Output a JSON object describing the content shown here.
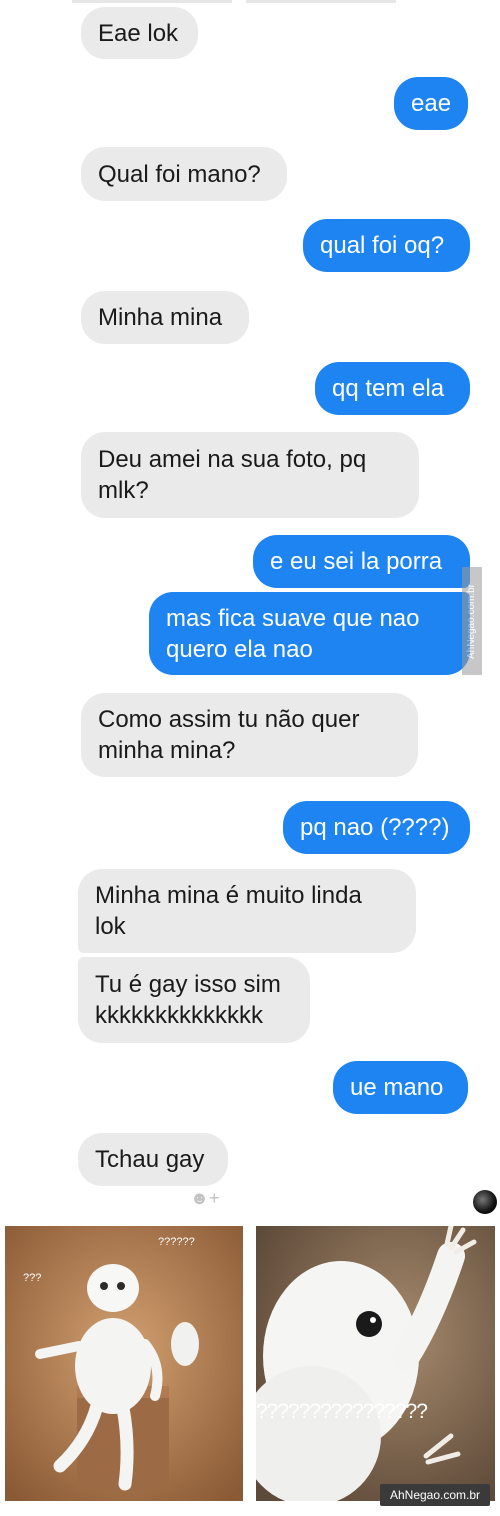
{
  "conversation": {
    "messages": [
      {
        "direction": "in",
        "text": "Eae lok"
      },
      {
        "direction": "out",
        "text": "eae"
      },
      {
        "direction": "in",
        "text": "Qual foi mano?"
      },
      {
        "direction": "out",
        "text": "qual foi oq?"
      },
      {
        "direction": "in",
        "text": "Minha mina"
      },
      {
        "direction": "out",
        "text": "qq tem ela"
      },
      {
        "direction": "in",
        "text": "Deu amei na sua foto, pq\nmlk?"
      },
      {
        "direction": "out",
        "text": "e eu sei la porra"
      },
      {
        "direction": "out",
        "text": "mas fica suave que nao\nquero ela nao"
      },
      {
        "direction": "in",
        "text": "Como assim tu não quer\nminha mina?"
      },
      {
        "direction": "out",
        "text": "pq nao (????)"
      },
      {
        "direction": "in",
        "text": "Minha mina é muito linda\nlok"
      },
      {
        "direction": "in",
        "text": "Tu é gay isso sim\nkkkkkkkkkkkkkk"
      },
      {
        "direction": "out",
        "text": "ue mano"
      },
      {
        "direction": "in",
        "text": "Tchau gay"
      }
    ],
    "reaction_icon": "smiley-plus-icon",
    "reaction_glyph": "☻+",
    "colors": {
      "incoming": "#eaeaeb",
      "outgoing": "#1d84f2"
    }
  },
  "watermark": {
    "side_text": "AhNegao.com.br",
    "bottom_text": "AhNegao.com.br"
  },
  "meme": {
    "left_label_small": "???",
    "left_label_top": "??????",
    "right_label": "????????????????"
  }
}
